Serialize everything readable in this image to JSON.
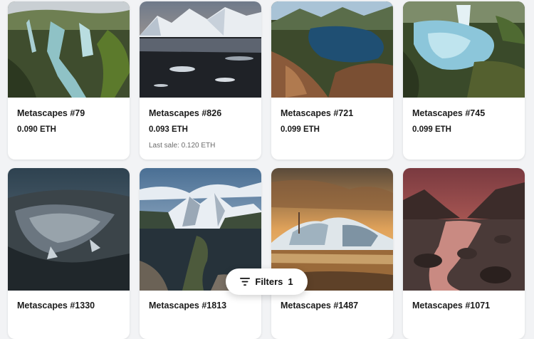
{
  "cards": [
    {
      "name": "Metascapes #79",
      "price": "0.090 ETH",
      "last_sale": ""
    },
    {
      "name": "Metascapes #826",
      "price": "0.093 ETH",
      "last_sale": "Last sale: 0.120 ETH"
    },
    {
      "name": "Metascapes #721",
      "price": "0.099 ETH",
      "last_sale": ""
    },
    {
      "name": "Metascapes #745",
      "price": "0.099 ETH",
      "last_sale": ""
    },
    {
      "name": "Metascapes #1330"
    },
    {
      "name": "Metascapes #1813"
    },
    {
      "name": "Metascapes #1487"
    },
    {
      "name": "Metascapes #1071"
    }
  ],
  "filter_bar": {
    "label": "Filters",
    "count": "1",
    "icon": "filter-icon"
  }
}
